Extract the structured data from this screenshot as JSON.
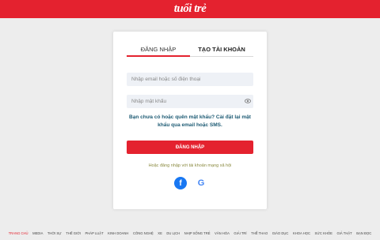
{
  "brand": {
    "logo_text": "tuổi trẻ",
    "colors": {
      "primary": "#e4222f",
      "link": "#1c5a73",
      "input_bg": "#eef1f6"
    }
  },
  "tabs": [
    {
      "label": "ĐĂNG NHẬP",
      "active": true
    },
    {
      "label": "TẠO TÀI KHOẢN",
      "active": false
    }
  ],
  "form": {
    "email_placeholder": "Nhập email hoặc số điện thoại",
    "email_value": "",
    "password_placeholder": "Nhập mật khẩu",
    "password_value": "",
    "password_toggle_icon": "eye-icon",
    "forgot_prefix": "Bạn chưa có hoặc quên mật khẩu?",
    "forgot_link": "Cài đặt lại mật khẩu qua email hoặc SMS.",
    "submit_label": "ĐĂNG NHẬP"
  },
  "social": {
    "label": "Hoặc đăng nhập với tài khoản mạng xã hội",
    "facebook": "f",
    "google": "G"
  },
  "footer_nav": [
    "TRANG CHỦ",
    "MEDIA",
    "THỜI SỰ",
    "THẾ GIỚI",
    "PHÁP LUẬT",
    "KINH DOANH",
    "CÔNG NGHỆ",
    "XE",
    "DU LỊCH",
    "NHỊP SỐNG TRẺ",
    "VĂN HÓA",
    "GIẢI TRÍ",
    "THỂ THAO",
    "GIÁO DỤC",
    "KHOA HỌC",
    "SỨC KHỎE",
    "GIẢ THẬT",
    "BẠN ĐỌC"
  ]
}
